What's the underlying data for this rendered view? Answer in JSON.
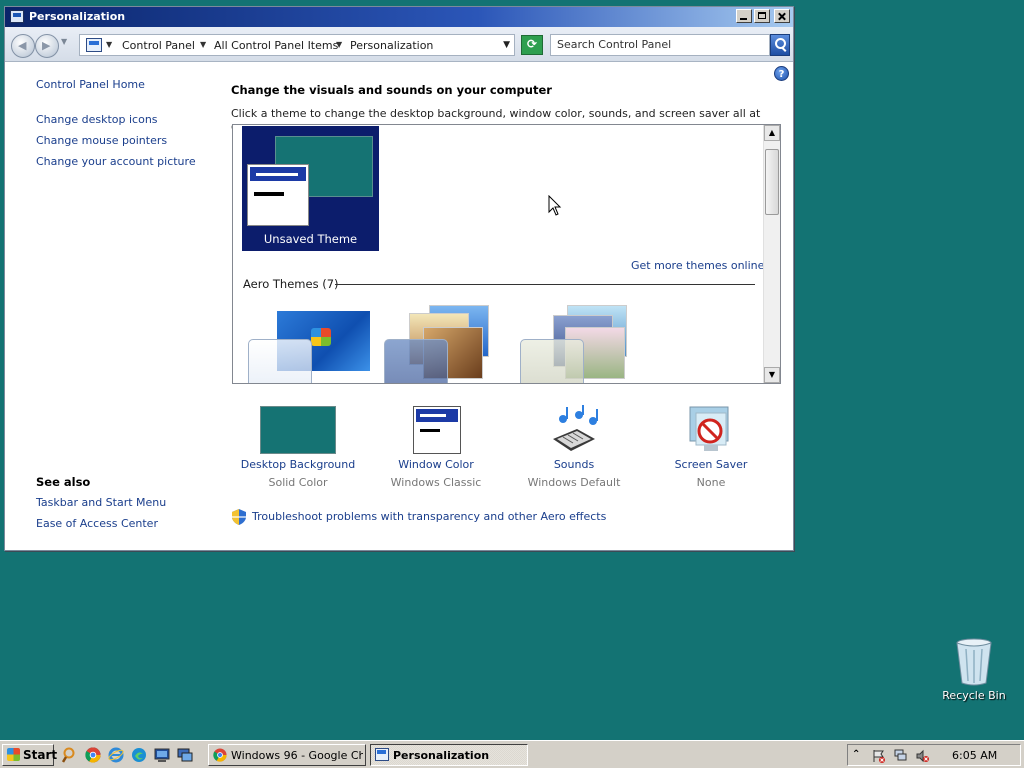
{
  "window": {
    "title": "Personalization",
    "address": {
      "crumbs": [
        "Control Panel",
        "All Control Panel Items",
        "Personalization"
      ],
      "search_placeholder": "Search Control Panel"
    }
  },
  "left_pane": {
    "home": "Control Panel Home",
    "links": [
      "Change desktop icons",
      "Change mouse pointers",
      "Change your account picture"
    ],
    "see_also_heading": "See also",
    "see_also": [
      "Taskbar and Start Menu",
      "Ease of Access Center"
    ]
  },
  "main": {
    "title": "Change the visuals and sounds on your computer",
    "description": "Click a theme to change the desktop background, window color, sounds, and screen saver all at once.",
    "unsaved_theme": "Unsaved Theme",
    "more_themes_link": "Get more themes online",
    "aero_heading": "Aero Themes (7)",
    "options": [
      {
        "label": "Desktop Background",
        "sub": "Solid Color"
      },
      {
        "label": "Window Color",
        "sub": "Windows Classic"
      },
      {
        "label": "Sounds",
        "sub": "Windows Default"
      },
      {
        "label": "Screen Saver",
        "sub": "None"
      }
    ],
    "troubleshoot": "Troubleshoot problems with transparency and other Aero effects"
  },
  "desktop": {
    "recycle_bin": "Recycle Bin",
    "background_color": "#137373"
  },
  "taskbar": {
    "start": "Start",
    "tasks": [
      {
        "label": "Windows 96 - Google Ch...",
        "icon": "chrome-icon",
        "active": false
      },
      {
        "label": "Personalization",
        "icon": "control-panel-icon",
        "active": true
      }
    ],
    "quick_launch": [
      "search-icon",
      "chrome-icon",
      "ie-icon",
      "edge-icon",
      "computer-icon",
      "network-icon"
    ],
    "clock": "6:05 AM"
  }
}
